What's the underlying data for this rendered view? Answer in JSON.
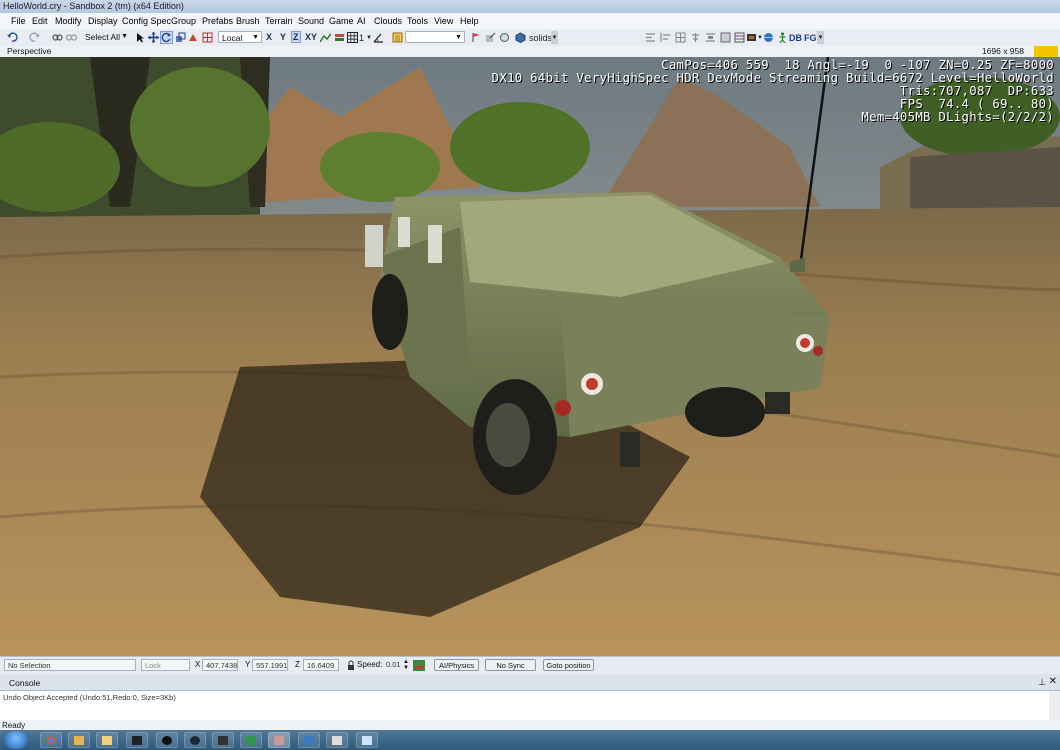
{
  "window": {
    "title": "HelloWorld.cry - Sandbox 2 (tm) (x64 Edition)"
  },
  "menu": [
    "File",
    "Edit",
    "Modify",
    "Display",
    "Config Spec",
    "Group",
    "Prefabs",
    "Brush",
    "Terrain",
    "Sound",
    "Game",
    "AI",
    "Clouds",
    "Tools",
    "View",
    "Help"
  ],
  "toolbar": {
    "select_all": "Select All",
    "coord_system": "Local",
    "axes": [
      "X",
      "Y",
      "Z",
      "XY"
    ],
    "active_axis": "Z",
    "snap_value": "1",
    "layer_dropdown": "",
    "solids_label": "solids",
    "db_label": "DB",
    "fg_label": "FG"
  },
  "viewport": {
    "name": "Perspective",
    "resolution": "1696 x 958",
    "hud_lines": [
      "CamPos=406 559  18 Angl=-19  0 -107 ZN=0.25 ZF=8000",
      "DX10 64bit VeryHighSpec HDR DevMode Streaming Build=6672 Level=HelloWorld",
      "Tris:707,087  DP:633",
      "FPS  74.4 ( 69.. 80)",
      "Mem=405MB DLights=(2/2/2)"
    ]
  },
  "statusbar": {
    "selection": "No Selection",
    "lock_selection": "Lock Selection",
    "x_label": "X",
    "x_value": "407.7438",
    "y_label": "Y",
    "y_value": "557.1991",
    "z_label": "Z",
    "z_value": "16.6409",
    "speed_label": "Speed:",
    "speed_value": "0.01",
    "ai_physics": "AI/Physics",
    "no_sync_player": "No Sync Player",
    "goto_position": "Goto position"
  },
  "console": {
    "title": "Console",
    "lines": [
      "Undo Object Accepted (Undo:51,Redo:0, Size=3Kb)"
    ]
  },
  "status_text": "Ready",
  "taskbar": {
    "apps": [
      "chrome-icon",
      "tools-icon",
      "explorer-icon",
      "terminal-icon",
      "obs-icon",
      "steam-icon",
      "game-icon",
      "publisher-icon",
      "sandbox-icon",
      "monitor-icon",
      "console-icon",
      "notepad-icon"
    ]
  }
}
